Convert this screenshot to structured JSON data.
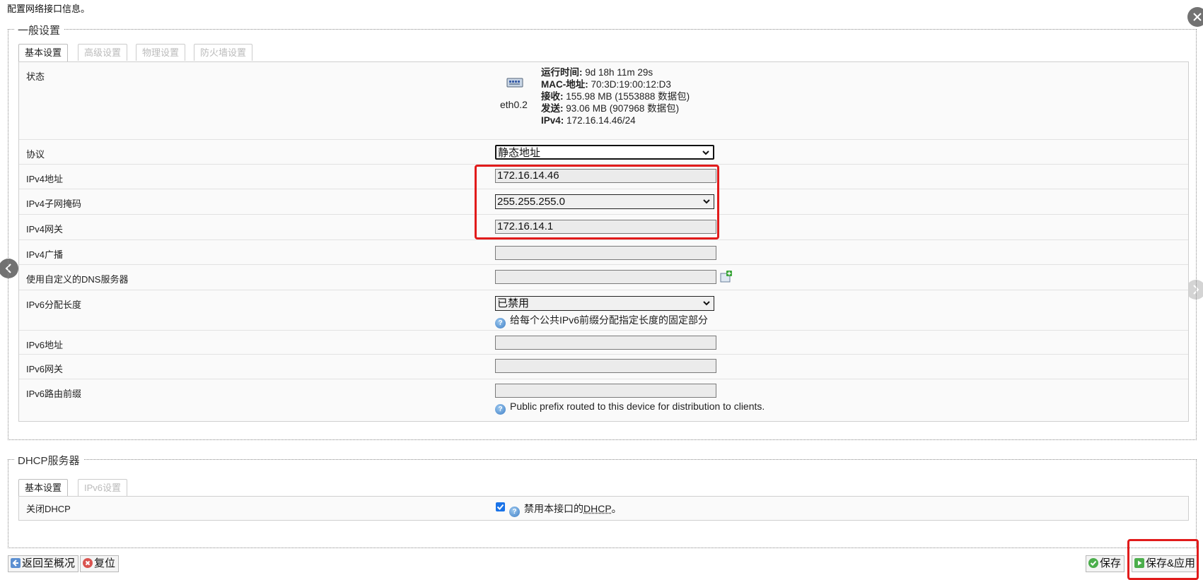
{
  "page": {
    "description": "配置网络接口信息。"
  },
  "general": {
    "legend": "一般设置",
    "tabs": [
      "基本设置",
      "高级设置",
      "物理设置",
      "防火墙设置"
    ],
    "status": {
      "label": "状态",
      "ifname": "eth0.2",
      "uptime_label": "运行时间:",
      "uptime_value": "9d 18h 11m 29s",
      "mac_label": "MAC-地址:",
      "mac_value": "70:3D:19:00:12:D3",
      "rx_label": "接收:",
      "rx_value": "155.98 MB (1553888 数据包)",
      "tx_label": "发送:",
      "tx_value": "93.06 MB (907968 数据包)",
      "ipv4_label": "IPv4:",
      "ipv4_value": "172.16.14.46/24",
      "icon": "network-interface-icon"
    },
    "protocol": {
      "label": "协议",
      "value": "静态地址"
    },
    "ipv4_addr": {
      "label": "IPv4地址",
      "value": "172.16.14.46"
    },
    "ipv4_mask": {
      "label": "IPv4子网掩码",
      "value": "255.255.255.0"
    },
    "ipv4_gw": {
      "label": "IPv4网关",
      "value": "172.16.14.1"
    },
    "ipv4_bcast": {
      "label": "IPv4广播",
      "value": ""
    },
    "dns": {
      "label": "使用自定义的DNS服务器",
      "value": "",
      "add_icon": "add-entry-icon"
    },
    "ip6assign": {
      "label": "IPv6分配长度",
      "value": "已禁用",
      "hint": "给每个公共IPv6前缀分配指定长度的固定部分"
    },
    "ip6addr": {
      "label": "IPv6地址",
      "value": ""
    },
    "ip6gw": {
      "label": "IPv6网关",
      "value": ""
    },
    "ip6prefix": {
      "label": "IPv6路由前缀",
      "value": "",
      "hint": "Public prefix routed to this device for distribution to clients."
    }
  },
  "dhcp": {
    "legend": "DHCP服务器",
    "tabs": [
      "基本设置",
      "IPv6设置"
    ],
    "ignore": {
      "label": "关闭DHCP",
      "checked": true,
      "hint_prefix": "禁用本接口的",
      "hint_link": "DHCP",
      "hint_suffix": "。"
    }
  },
  "footer": {
    "back": "返回至概况",
    "reset": "复位",
    "save": "保存",
    "save_apply": "保存&应用"
  },
  "colors": {
    "highlight": "#e11b1b",
    "checkbox": "#1a73e8",
    "help_icon": "#3f7fc6"
  }
}
